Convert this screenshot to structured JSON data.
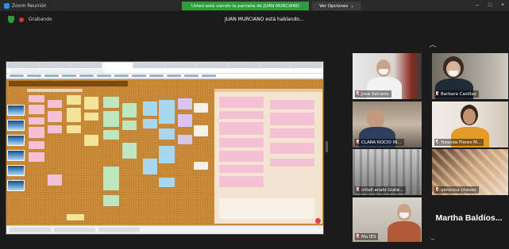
{
  "app": {
    "title": "Zoom Reunión",
    "share_banner": "Usted está viendo la pantalla de JUAN MURCIANO",
    "view_options": "Ver Opciones",
    "recording_label": "Grabando",
    "speaking_label": "JUAN MURCIANO está hablando..."
  },
  "colors": {
    "banner": "#2e9d3a",
    "recording": "#e03131",
    "board_cork": "#c98a3a"
  },
  "participants": [
    {
      "name": "Jose Serrano",
      "muted": true
    },
    {
      "name": "Barbara Casillas",
      "muted": true
    },
    {
      "name": "CLARA ROCIO IN...",
      "muted": true
    },
    {
      "name": "Yolanda Flores M...",
      "muted": true
    },
    {
      "name": "citlali anahi Gutié...",
      "muted": true
    },
    {
      "name": "veronica chavez",
      "muted": true
    },
    {
      "name": "Ma IES",
      "muted": true
    },
    {
      "name": "Martha Baldíos...",
      "muted": false,
      "video": false
    }
  ],
  "icons": {
    "share": "shield-icon",
    "recording": "record-dot-icon",
    "scroll_up": "chevron-up-icon",
    "scroll_down": "chevron-down-icon",
    "mute": "mic-muted-icon"
  }
}
